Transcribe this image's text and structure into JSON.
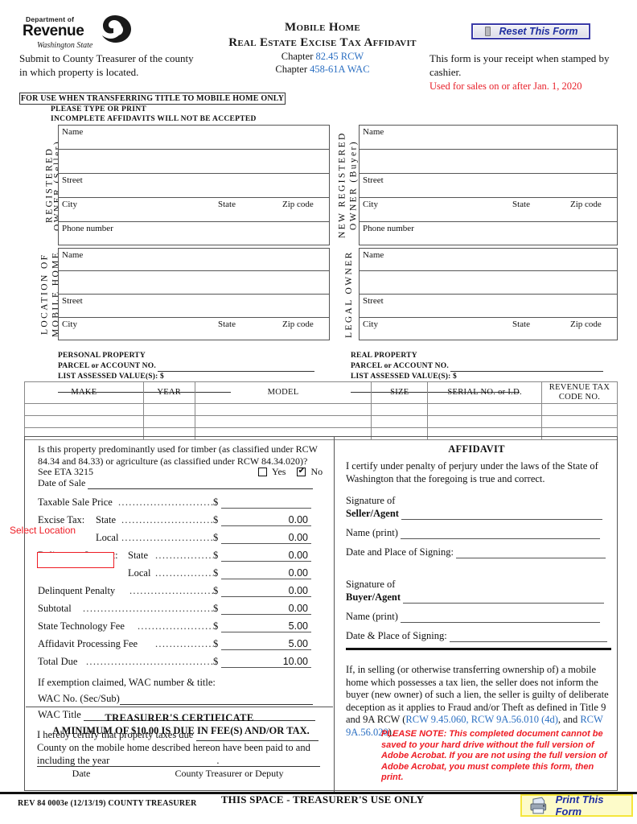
{
  "header": {
    "logo": {
      "line1": "Department of",
      "line2": "Revenue",
      "line3": "Washington State"
    },
    "title_line1": "Mobile Home",
    "title_line2": "Real Estate Excise Tax Affidavit",
    "chapter1_prefix": "Chapter ",
    "chapter1_link": "82.45 RCW",
    "chapter2_prefix": "Chapter ",
    "chapter2_link": "458-61A WAC",
    "submit_text": "Submit to County Treasurer of the county in which property is located.",
    "receipt_text": "This form is your receipt when stamped by cashier.",
    "used_for_sales": "Used for sales on or after Jan. 1, 2020",
    "reset_button": "Reset This Form"
  },
  "notices": {
    "for_use": "FOR USE WHEN TRANSFERRING TITLE TO MOBILE HOME ONLY",
    "please_type": "PLEASE TYPE OR PRINT",
    "incomplete": "INCOMPLETE AFFIDAVITS WILL NOT BE ACCEPTED"
  },
  "parties": {
    "seller": {
      "vlabel_line1": "REGISTERED",
      "vlabel_line2": "OWNER (Seller)"
    },
    "buyer": {
      "vlabel_line1": "NEW REGISTERED",
      "vlabel_line2": "OWNER (Buyer)"
    },
    "location": {
      "vlabel_line1": "LOCATION OF",
      "vlabel_line2": "MOBILE HOME"
    },
    "legal": {
      "vlabel_line1": "LEGAL OWNER",
      "vlabel_line2": ""
    },
    "fields": {
      "name": "Name",
      "street": "Street",
      "city": "City",
      "state": "State",
      "zip": "Zip code",
      "phone": "Phone number"
    }
  },
  "property": {
    "personal_title": "PERSONAL PROPERTY",
    "real_title": "REAL PROPERTY",
    "parcel_label": "PARCEL or ACCOUNT NO.",
    "assessed_label": "LIST ASSESSED VALUE(S): $"
  },
  "table": {
    "headers": [
      "MAKE",
      "YEAR",
      "MODEL",
      "SIZE",
      "SERIAL NO. or I.D.",
      "REVENUE TAX CODE NO."
    ],
    "header_last_line1": "REVENUE TAX",
    "header_last_line2": "CODE NO.",
    "rows": [
      [
        "",
        "",
        "",
        "",
        "",
        ""
      ],
      [
        "",
        "",
        "",
        "",
        "",
        ""
      ],
      [
        "",
        "",
        "",
        "",
        "",
        ""
      ]
    ]
  },
  "timber": {
    "question": "Is this property predominantly used for timber (as classified under RCW 84.34 and 84.33) or agriculture (as classified under RCW 84.34.020)?",
    "see_eta": "See ETA 3215",
    "yes_label": "Yes",
    "no_label": "No",
    "yes_checked": false,
    "no_checked": true,
    "date_of_sale": "Date of Sale"
  },
  "select_location": "Select Location",
  "money_rows": [
    {
      "label": "Taxable Sale Price",
      "sub": "",
      "value": ""
    },
    {
      "label": "Excise Tax:",
      "sub": "State",
      "value": "0.00"
    },
    {
      "label": "",
      "sub": "Local",
      "value": "0.00"
    },
    {
      "label": "Delinquent Interest:",
      "sub": "State",
      "value": "0.00"
    },
    {
      "label": "",
      "sub": "Local",
      "value": "0.00"
    },
    {
      "label": "Delinquent Penalty",
      "sub": "",
      "value": "0.00"
    },
    {
      "label": "Subtotal",
      "sub": "",
      "value": "0.00"
    },
    {
      "label": "State Technology Fee",
      "sub": "",
      "value": "5.00"
    },
    {
      "label": "Affidavit Processing Fee",
      "sub": "",
      "value": "5.00"
    },
    {
      "label": "Total Due",
      "sub": "",
      "value": "10.00"
    }
  ],
  "exemption": {
    "intro": "If exemption claimed, WAC number & title:",
    "wac_no_label": "WAC No. (Sec/Sub)",
    "wac_title_label": "WAC Title",
    "minimum": "A MINIMUM OF $10.00 IS DUE IN FEE(S) AND/OR TAX."
  },
  "treasurer": {
    "heading": "TREASURER'S CERTIFICATE",
    "body_part1": "I hereby certify that property taxes due",
    "body_part2": "County on the mobile home described hereon have been paid to and including the year",
    "date_label": "Date",
    "signer_label": "County Treasurer or Deputy"
  },
  "affidavit": {
    "heading": "AFFIDAVIT",
    "body": "I certify under penalty of perjury under the laws of the State of Washington that the foregoing is true and correct.",
    "sig_of": "Signature of",
    "seller_agent": "Seller/Agent",
    "buyer_agent": "Buyer/Agent",
    "name_print": "Name (print)",
    "date_place_seller": "Date and Place of Signing:",
    "date_place_buyer": "Date & Place of Signing:"
  },
  "lien": {
    "text_part1": "If, in selling (or otherwise transferring ownership of) a mobile home which possesses a tax lien, the seller does not inform the buyer (new owner) of such a lien, the seller is guilty of deliberate deception as it applies to Fraud and/or Theft as defined in Title 9 and 9A RCW (",
    "link1": "RCW 9.45.060, RCW 9A.56.010 (4d)",
    "mid": ", and ",
    "link2": "RCW 9A.56.020",
    "text_end": ")."
  },
  "please_note": "PLEASE NOTE: This completed document cannot be saved to your hard drive without the full version of Adobe Acrobat. If you are not using the full version of Adobe Acrobat, you must complete this form, then print.",
  "footer": {
    "this_space": "THIS SPACE - TREASURER'S USE ONLY",
    "rev_no": "REV 84 0003e (12/13/19) COUNTY TREASURER",
    "print_button": "Print This Form"
  },
  "colors": {
    "link_blue": "#2b6fc2",
    "alert_red": "#ee1c24",
    "button_blue": "#1f2fa0",
    "print_bg": "#fdfbc9"
  }
}
